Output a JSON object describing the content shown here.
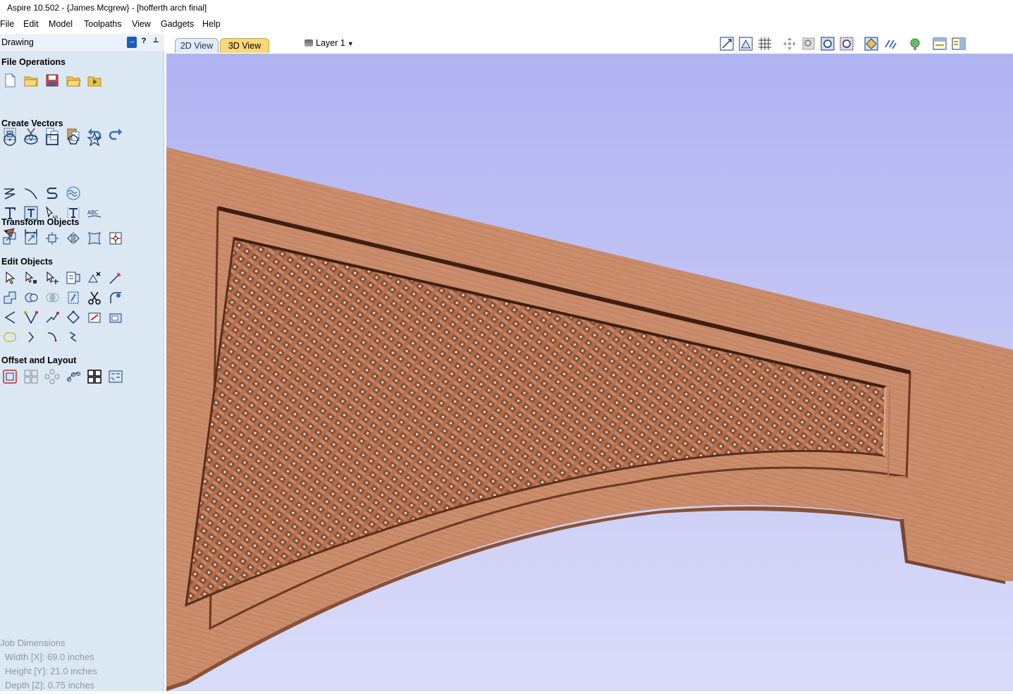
{
  "window": {
    "title": "Aspire 10.502 - {James Mcgrew} - [hofferth arch final]"
  },
  "menu": {
    "items": [
      "File",
      "Edit",
      "Model",
      "Toolpaths",
      "View",
      "Gadgets",
      "Help"
    ]
  },
  "sidebar": {
    "title": "Drawing",
    "help_label": "?",
    "sections": {
      "file_operations": "File Operations",
      "create_vectors": "Create Vectors",
      "transform_objects": "Transform Objects",
      "edit_objects": "Edit Objects",
      "offset_layout": "Offset and Layout"
    }
  },
  "job": {
    "heading": "Job Dimensions",
    "width": "Width  [X]: 69.0 inches",
    "height": "Height [Y]: 21.0 inches",
    "depth": "Depth  [Z]: 0.75 inches"
  },
  "views": {
    "tab_2d": "2D View",
    "tab_3d": "3D View",
    "active": "3D View"
  },
  "layer": {
    "label": "Layer 1"
  },
  "colors": {
    "sidebar_bg": "#dbe8f4",
    "wood": "#c98b6a",
    "wood_dark": "#6b3a22",
    "sky_top": "#b0b3f2",
    "sky_bottom": "#d9dcf9",
    "tab_active": "#f7d87a"
  }
}
